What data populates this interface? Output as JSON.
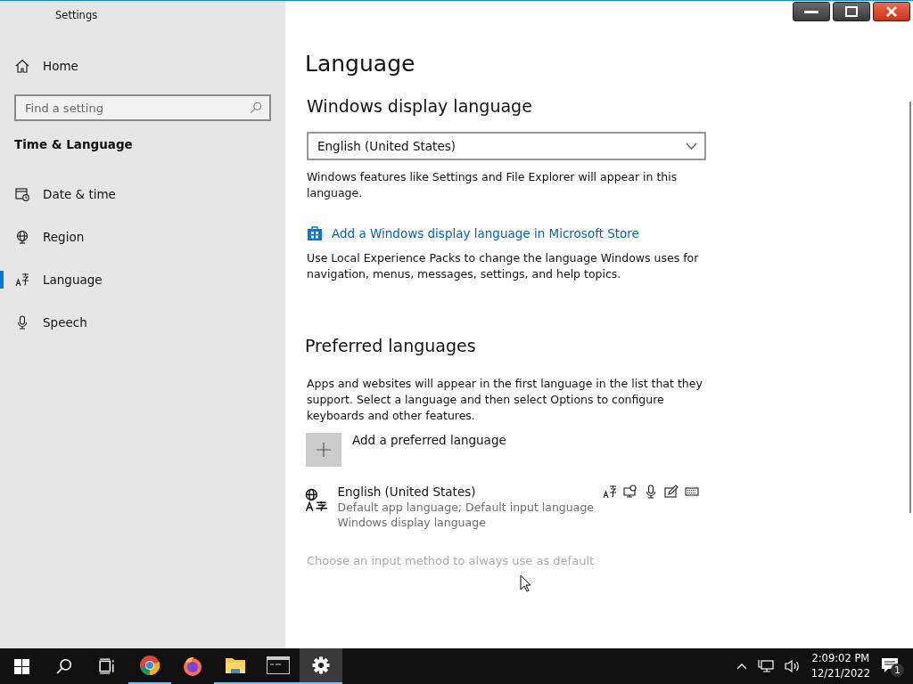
{
  "window": {
    "title": "Settings"
  },
  "sidebar": {
    "home": "Home",
    "search": {
      "placeholder": "Find a setting"
    },
    "section": "Time & Language",
    "items": [
      {
        "label": "Date & time",
        "selected": false
      },
      {
        "label": "Region",
        "selected": false
      },
      {
        "label": "Language",
        "selected": true
      },
      {
        "label": "Speech",
        "selected": false
      }
    ]
  },
  "main": {
    "title": "Language",
    "display_heading": "Windows display language",
    "display_value": "English (United States)",
    "display_note": "Windows features like Settings and File Explorer will appear in this language.",
    "store_link": "Add a Windows display language in Microsoft Store",
    "store_note": "Use Local Experience Packs to change the language Windows uses for navigation, menus, messages, settings, and help topics.",
    "preferred_heading": "Preferred languages",
    "preferred_note": "Apps and websites will appear in the first language in the list that they support. Select a language and then select Options to configure keyboards and other features.",
    "add_language": "Add a preferred language",
    "languages": [
      {
        "name": "English (United States)",
        "details": [
          "Default app language; Default input language",
          "Windows display language"
        ]
      }
    ],
    "input_method_link": "Choose an input method to always use as default"
  },
  "taskbar": {
    "apps": [
      {
        "kind": "start",
        "open": false,
        "selected": false
      },
      {
        "kind": "search",
        "open": false,
        "selected": false
      },
      {
        "kind": "taskview",
        "open": false,
        "selected": false
      },
      {
        "kind": "chrome",
        "open": true,
        "selected": false
      },
      {
        "kind": "firefox",
        "open": false,
        "selected": false
      },
      {
        "kind": "explorer",
        "open": true,
        "selected": false
      },
      {
        "kind": "terminal",
        "open": true,
        "selected": false
      },
      {
        "kind": "settings",
        "open": true,
        "selected": true
      }
    ],
    "time": "2:09:02 PM",
    "date": "12/21/2022",
    "notifications": "1"
  }
}
